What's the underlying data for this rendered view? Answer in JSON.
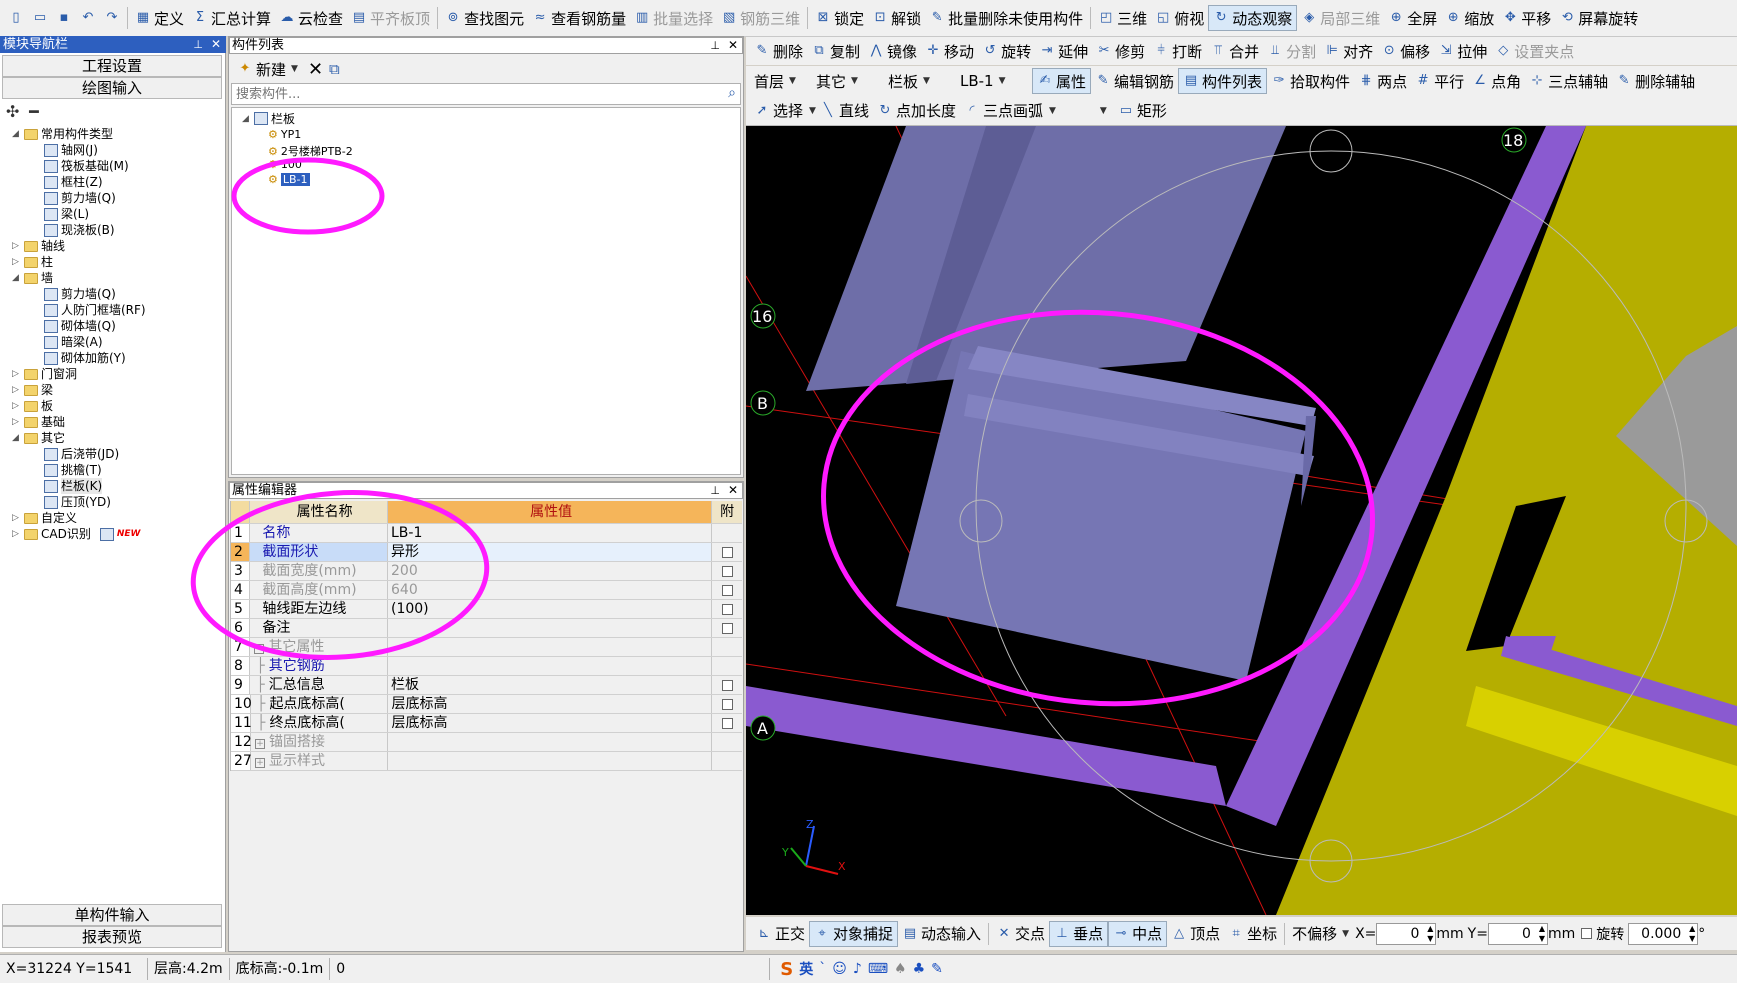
{
  "toolbar1": [
    {
      "icon": "page-icon",
      "label": ""
    },
    {
      "icon": "open-folder-icon",
      "label": ""
    },
    {
      "icon": "save-icon",
      "label": ""
    },
    {
      "icon": "undo-icon",
      "label": ""
    },
    {
      "icon": "redo-icon",
      "label": ""
    },
    {
      "icon": "table-icon",
      "label": "定义"
    },
    {
      "icon": "sigma-icon",
      "label": "汇总计算"
    },
    {
      "icon": "cloud-check-icon",
      "label": "云检查"
    },
    {
      "icon": "align-slab-icon",
      "label": "平齐板顶",
      "disabled": true
    },
    {
      "icon": "binoculars-icon",
      "label": "查找图元"
    },
    {
      "icon": "rebar-icon",
      "label": "查看钢筋量"
    },
    {
      "icon": "batch-select-icon",
      "label": "批量选择",
      "disabled": true
    },
    {
      "icon": "rebar-3d-icon",
      "label": "钢筋三维",
      "disabled": true
    },
    {
      "icon": "lock-icon",
      "label": "锁定"
    },
    {
      "icon": "unlock-icon",
      "label": "解锁"
    },
    {
      "icon": "batch-delete-icon",
      "label": "批量删除未使用构件"
    },
    {
      "icon": "cube-icon",
      "label": "三维"
    },
    {
      "icon": "top-view-icon",
      "label": "俯视"
    },
    {
      "icon": "orbit-icon",
      "label": "动态观察",
      "active": true
    },
    {
      "icon": "local-3d-icon",
      "label": "局部三维",
      "disabled": true
    },
    {
      "icon": "zoom-icon",
      "label": "全屏"
    },
    {
      "icon": "zoom-icon",
      "label": "缩放"
    },
    {
      "icon": "pan-icon",
      "label": "平移"
    },
    {
      "icon": "rotate-screen-icon",
      "label": "屏幕旋转"
    }
  ],
  "toolbar2": [
    {
      "icon": "delete-icon",
      "label": "删除"
    },
    {
      "icon": "copy-icon",
      "label": "复制"
    },
    {
      "icon": "mirror-icon",
      "label": "镜像"
    },
    {
      "icon": "move-icon",
      "label": "移动"
    },
    {
      "icon": "rotate-icon",
      "label": "旋转"
    },
    {
      "icon": "extend-icon",
      "label": "延伸"
    },
    {
      "icon": "trim-icon",
      "label": "修剪"
    },
    {
      "icon": "break-icon",
      "label": "打断"
    },
    {
      "icon": "merge-icon",
      "label": "合并"
    },
    {
      "icon": "split-icon",
      "label": "分割",
      "disabled": true
    },
    {
      "icon": "align-icon",
      "label": "对齐"
    },
    {
      "icon": "offset-icon",
      "label": "偏移"
    },
    {
      "icon": "stretch-icon",
      "label": "拉伸"
    },
    {
      "icon": "grip-icon",
      "label": "设置夹点",
      "disabled": true
    }
  ],
  "toolbar3": {
    "floor": "首层",
    "type1": "其它",
    "type2": "栏板",
    "component": "LB-1",
    "items": [
      {
        "icon": "property-icon",
        "label": "属性",
        "active": true
      },
      {
        "icon": "edit-rebar-icon",
        "label": "编辑钢筋"
      },
      {
        "icon": "list-icon",
        "label": "构件列表",
        "active": true
      },
      {
        "icon": "pick-icon",
        "label": "拾取构件"
      },
      {
        "icon": "two-point-icon",
        "label": "两点"
      },
      {
        "icon": "parallel-icon",
        "label": "平行"
      },
      {
        "icon": "point-angle-icon",
        "label": "点角"
      },
      {
        "icon": "three-point-aux-icon",
        "label": "三点辅轴"
      },
      {
        "icon": "delete-aux-icon",
        "label": "删除辅轴"
      }
    ]
  },
  "toolbar4": [
    {
      "icon": "cursor-icon",
      "label": "选择"
    },
    {
      "icon": "line-icon",
      "label": "直线"
    },
    {
      "icon": "point-length-icon",
      "label": "点加长度"
    },
    {
      "icon": "arc-icon",
      "label": "三点画弧"
    },
    {
      "icon": "",
      "label": ""
    },
    {
      "icon": "rectangle-icon",
      "label": "矩形"
    }
  ],
  "nav": {
    "title": "模块导航栏",
    "btn1": "工程设置",
    "btn2": "绘图输入",
    "bottom1": "单构件输入",
    "bottom2": "报表预览",
    "tree": [
      {
        "lvl": 0,
        "exp": "◢",
        "icon": "folder",
        "label": "常用构件类型"
      },
      {
        "lvl": 1,
        "icon": "comp",
        "label": "轴网(J)"
      },
      {
        "lvl": 1,
        "icon": "comp",
        "label": "筏板基础(M)"
      },
      {
        "lvl": 1,
        "icon": "comp",
        "label": "框柱(Z)"
      },
      {
        "lvl": 1,
        "icon": "comp",
        "label": "剪力墙(Q)"
      },
      {
        "lvl": 1,
        "icon": "comp",
        "label": "梁(L)"
      },
      {
        "lvl": 1,
        "icon": "comp",
        "label": "现浇板(B)"
      },
      {
        "lvl": 0,
        "exp": "▷",
        "icon": "folder",
        "label": "轴线"
      },
      {
        "lvl": 0,
        "exp": "▷",
        "icon": "folder",
        "label": "柱"
      },
      {
        "lvl": 0,
        "exp": "◢",
        "icon": "folder",
        "label": "墙"
      },
      {
        "lvl": 1,
        "icon": "comp",
        "label": "剪力墙(Q)"
      },
      {
        "lvl": 1,
        "icon": "comp",
        "label": "人防门框墙(RF)"
      },
      {
        "lvl": 1,
        "icon": "comp",
        "label": "砌体墙(Q)"
      },
      {
        "lvl": 1,
        "icon": "comp",
        "label": "暗梁(A)"
      },
      {
        "lvl": 1,
        "icon": "comp",
        "label": "砌体加筋(Y)"
      },
      {
        "lvl": 0,
        "exp": "▷",
        "icon": "folder",
        "label": "门窗洞"
      },
      {
        "lvl": 0,
        "exp": "▷",
        "icon": "folder",
        "label": "梁"
      },
      {
        "lvl": 0,
        "exp": "▷",
        "icon": "folder",
        "label": "板"
      },
      {
        "lvl": 0,
        "exp": "▷",
        "icon": "folder",
        "label": "基础"
      },
      {
        "lvl": 0,
        "exp": "◢",
        "icon": "folder",
        "label": "其它"
      },
      {
        "lvl": 1,
        "icon": "comp",
        "label": "后浇带(JD)"
      },
      {
        "lvl": 1,
        "icon": "comp",
        "label": "挑檐(T)"
      },
      {
        "lvl": 1,
        "icon": "comp",
        "label": "栏板(K)"
      },
      {
        "lvl": 1,
        "icon": "comp",
        "label": "压顶(YD)"
      },
      {
        "lvl": 0,
        "exp": "▷",
        "icon": "folder",
        "label": "自定义"
      },
      {
        "lvl": 0,
        "exp": "▷",
        "icon": "folder",
        "label": "CAD识别",
        "badge": "NEW"
      }
    ]
  },
  "complist": {
    "title": "构件列表",
    "new_label": "新建",
    "search_placeholder": "搜索构件...",
    "root": "栏板",
    "items": [
      "YP1",
      "2号楼梯PTB-2",
      "100",
      "LB-1"
    ],
    "selected": "LB-1"
  },
  "props": {
    "title": "属性编辑器",
    "col_name": "属性名称",
    "col_value": "属性值",
    "col_attach": "附",
    "rows": [
      {
        "n": "1",
        "k": "名称",
        "v": "LB-1",
        "blue": true,
        "cb": false
      },
      {
        "n": "2",
        "k": "截面形状",
        "v": "异形",
        "blue": true,
        "cb": true,
        "selected": true
      },
      {
        "n": "3",
        "k": "截面宽度(mm)",
        "v": "200",
        "gray": true,
        "cb": true
      },
      {
        "n": "4",
        "k": "截面高度(mm)",
        "v": "640",
        "gray": true,
        "cb": true
      },
      {
        "n": "5",
        "k": "轴线距左边线",
        "v": "(100)",
        "cb": true
      },
      {
        "n": "6",
        "k": "备注",
        "v": "",
        "cb": true
      },
      {
        "n": "7",
        "k": "其它属性",
        "v": "",
        "gray": true,
        "cb": false,
        "group": "-"
      },
      {
        "n": "8",
        "k": "其它钢筋",
        "v": "",
        "blue": true,
        "cb": false,
        "child": true
      },
      {
        "n": "9",
        "k": "汇总信息",
        "v": "栏板",
        "cb": true,
        "child": true
      },
      {
        "n": "10",
        "k": "起点底标高(",
        "v": "层底标高",
        "cb": true,
        "child": true
      },
      {
        "n": "11",
        "k": "终点底标高(",
        "v": "层底标高",
        "cb": true,
        "child": true
      },
      {
        "n": "12",
        "k": "锚固搭接",
        "v": "",
        "gray": true,
        "cb": false,
        "group": "+"
      },
      {
        "n": "27",
        "k": "显示样式",
        "v": "",
        "gray": true,
        "cb": false,
        "group": "+"
      }
    ]
  },
  "viewport": {
    "axis_labels": [
      "18",
      "16",
      "B",
      "A"
    ],
    "axis_x": "X",
    "axis_y": "Y",
    "axis_z": "Z"
  },
  "bottom": {
    "items": [
      {
        "icon": "ortho-icon",
        "label": "正交"
      },
      {
        "icon": "snap-icon",
        "label": "对象捕捉",
        "active": true
      },
      {
        "icon": "dynamic-input-icon",
        "label": "动态输入"
      },
      {
        "icon": "intersect-icon",
        "label": "交点"
      },
      {
        "icon": "perpendicular-icon",
        "label": "垂点",
        "active": true
      },
      {
        "icon": "midpoint-icon",
        "label": "中点",
        "active": true
      },
      {
        "icon": "vertex-icon",
        "label": "顶点"
      },
      {
        "icon": "coordinate-icon",
        "label": "坐标"
      }
    ],
    "offset_mode": "不偏移",
    "x_label": "X=",
    "x_value": "0",
    "x_unit": "mm",
    "y_label": "Y=",
    "y_value": "0",
    "y_unit": "mm",
    "rotate_label": "旋转",
    "rotate_value": "0.000",
    "deg": "°"
  },
  "status": {
    "coords": "X=31224 Y=1541",
    "floor_height": "层高:4.2m",
    "base_elev": "底标高:-0.1m",
    "extra": "0",
    "ime": "英"
  },
  "colors": {
    "panel_bar": "#2d5fbf",
    "slab": "#6e6ea8",
    "wall_yellow": "#b5ae00",
    "wall_purple": "#8a5ad0",
    "annotation": "#ff1aff",
    "grid_red": "#d01010"
  }
}
